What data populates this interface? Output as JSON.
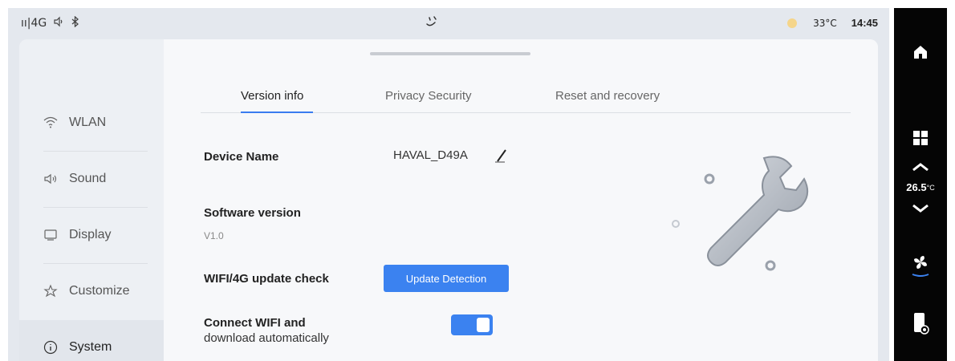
{
  "status_bar": {
    "signal": "ıı|4G",
    "volume_icon": "volume-icon",
    "bluetooth_icon": "bluetooth-icon",
    "weather_temp": "33°C",
    "time": "14:45"
  },
  "sidebar": {
    "items": [
      {
        "label": "WLAN",
        "icon": "wifi-icon",
        "active": false
      },
      {
        "label": "Sound",
        "icon": "speaker-icon",
        "active": false
      },
      {
        "label": "Display",
        "icon": "monitor-icon",
        "active": false
      },
      {
        "label": "Customize",
        "icon": "customize-icon",
        "active": false
      },
      {
        "label": "System",
        "icon": "info-icon",
        "active": true
      }
    ]
  },
  "tabs": [
    {
      "label": "Version info",
      "active": true
    },
    {
      "label": "Privacy Security",
      "active": false
    },
    {
      "label": "Reset and recovery",
      "active": false
    }
  ],
  "system": {
    "device_name_label": "Device Name",
    "device_name_value": "HAVAL_D49A",
    "software_version_label": "Software version",
    "software_version_value": "V1.0",
    "update_check_label": "WIFI/4G update check",
    "update_button_label": "Update Detection",
    "auto_download_label_line1": "Connect WIFI and",
    "auto_download_label_line2": "download automatically",
    "auto_download_enabled": true
  },
  "dock": {
    "climate_temp": "26.5",
    "climate_unit": "°C",
    "icons": [
      "home-icon",
      "apps-icon",
      "temp-up-icon",
      "temp-down-icon",
      "fan-icon",
      "phone-icon"
    ]
  },
  "colors": {
    "accent": "#3b82f0",
    "dock_bg": "#050505"
  }
}
